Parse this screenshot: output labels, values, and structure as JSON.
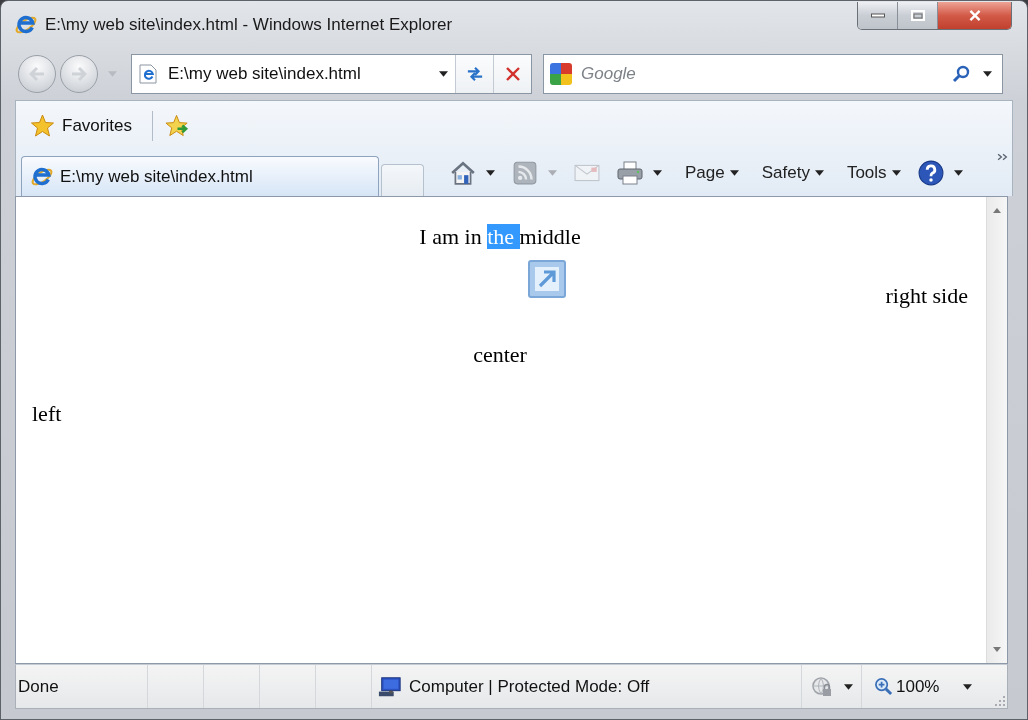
{
  "window": {
    "title": "E:\\my web site\\index.html - Windows Internet Explorer"
  },
  "navigation": {
    "back": {
      "disabled": true
    },
    "forward": {
      "disabled": true
    },
    "address": "E:\\my web site\\index.html",
    "search": {
      "placeholder": "Google"
    }
  },
  "favorites_bar": {
    "label": "Favorites"
  },
  "tabs": [
    {
      "label": "E:\\my web site\\index.html",
      "selected": true
    }
  ],
  "command_bar": {
    "items": [
      {
        "kind": "home",
        "disabled": false
      },
      {
        "kind": "feeds",
        "disabled": true
      },
      {
        "kind": "mail",
        "disabled": true
      },
      {
        "kind": "print",
        "disabled": false
      },
      {
        "kind": "menu",
        "label": "Page",
        "disabled": false
      },
      {
        "kind": "menu",
        "label": "Safety",
        "disabled": false
      },
      {
        "kind": "menu",
        "label": "Tools",
        "disabled": false
      },
      {
        "kind": "help",
        "disabled": false
      }
    ]
  },
  "page": {
    "lines": [
      {
        "kind": "centered",
        "segments": [
          {
            "text": "I am in ",
            "selected": false
          },
          {
            "text": "the ",
            "selected": true
          },
          {
            "text": "middle",
            "selected": false
          }
        ]
      },
      {
        "kind": "right",
        "segments": [
          {
            "text": "right side",
            "selected": false
          }
        ]
      },
      {
        "kind": "centered",
        "segments": [
          {
            "text": "center",
            "selected": false
          }
        ]
      },
      {
        "kind": "left",
        "segments": [
          {
            "text": "left",
            "selected": false
          }
        ]
      }
    ]
  },
  "status_bar": {
    "status": "Done",
    "zone": "Computer | Protected Mode: Off",
    "zoom": "100%"
  }
}
